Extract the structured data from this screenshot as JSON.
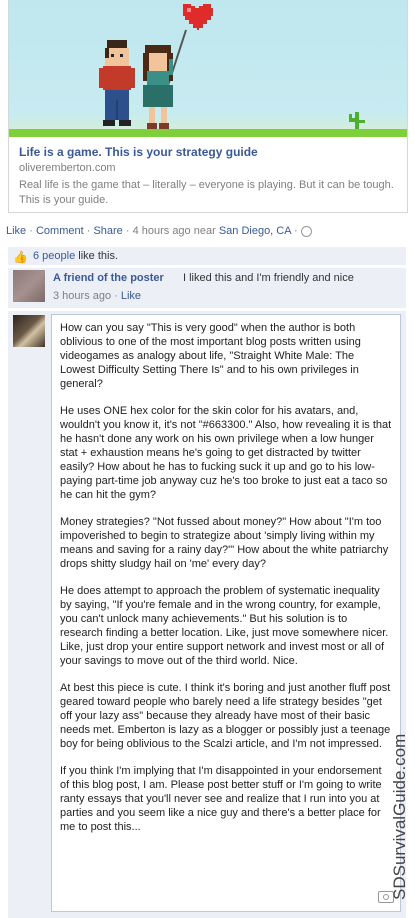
{
  "link_preview": {
    "title": "Life is a game. This is your strategy guide",
    "domain": "oliveremberton.com",
    "description": "Real life is the game that – literally – everyone is playing. But it can be tough. This is your guide."
  },
  "actions": {
    "like": "Like",
    "sep1": " · ",
    "comment": "Comment",
    "sep2": " · ",
    "share": "Share",
    "meta": " · 4 hours ago near ",
    "location": "San Diego, CA",
    "tail": " · "
  },
  "likes": {
    "count_link": "6 people",
    "suffix": " like this."
  },
  "comment": {
    "author": "A friend of the poster",
    "text": "I liked this and I'm friendly and nice",
    "time": "3 hours ago · ",
    "like": "Like"
  },
  "draft": {
    "paragraphs": [
      "How can you say \"This is very good\" when the author is both oblivious to one of the most important blog posts written using videogames as analogy about life, \"Straight White Male: The Lowest Difficulty Setting There Is\" and to his own privileges in general?",
      "He uses ONE hex color for the skin color for his avatars, and, wouldn't you know it, it's not \"#663300.\" Also, how revealing it is that he hasn't done any work on his own privilege when a low hunger stat + exhaustion means he's going to get distracted by twitter easily? How about he has to fucking suck it up and go to his low-paying part-time job anyway cuz he's too broke to just eat a taco so he can hit the gym?",
      "Money strategies? \"Not fussed about money?\" How about \"I'm too impoverished to begin to strategize about 'simply living within my means and saving for a rainy day?'\" How about the white patriarchy drops shitty sludgy hail on 'me' every day?",
      "He does attempt to approach the problem of systematic inequality by saying, \"If you're female and in the wrong country, for example, you can't unlock many achievements.\" But his solution is to research finding a better location. Like, just move somewhere nicer. Like, just drop your entire support network and invest most or all of your savings to move out of the third world. Nice.",
      "At best this piece is cute. I think it's boring and just another fluff post geared toward people who barely need a life strategy besides \"get off your lazy ass\" because they already have most of their basic needs met. Emberton is lazy as a blogger or possibly just a teenage boy for being oblivious to the Scalzi article, and I'm not impressed.",
      "If you think I'm implying that I'm disappointed in your endorsement of this blog post, I am. Please post better stuff or I'm going to write ranty essays that you'll never see and realize that I run into you at parties and you seem like a nice guy and there's a better place for me to post this..."
    ]
  },
  "watermark": "SDSurvivalGuide.com"
}
